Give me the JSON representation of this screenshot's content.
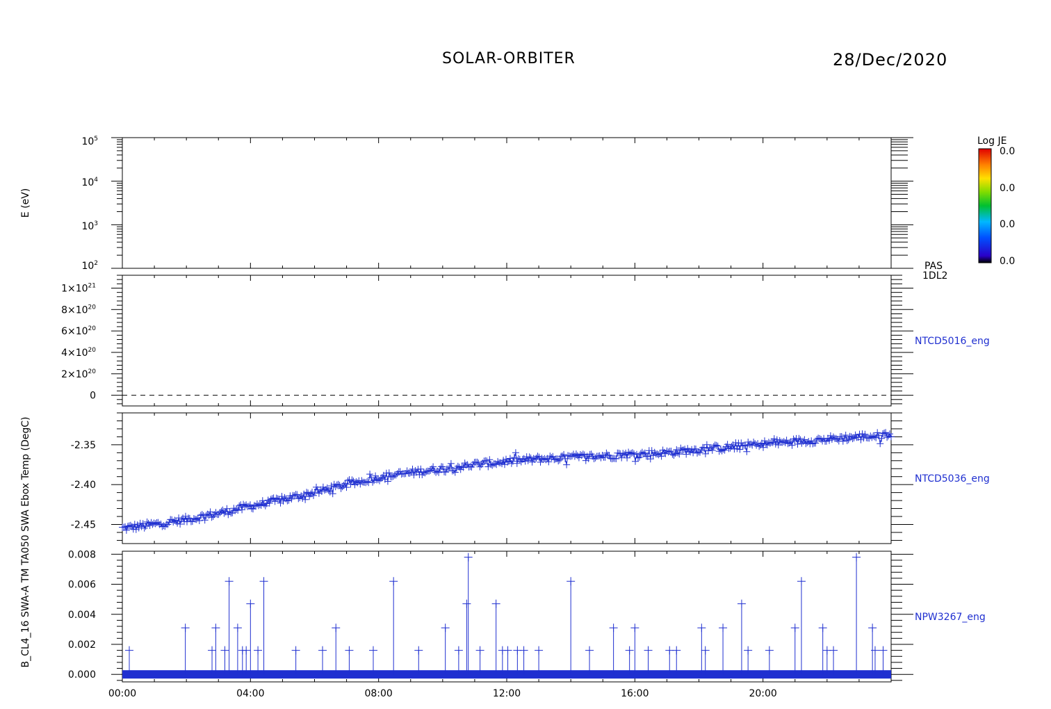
{
  "header": {
    "title": "SOLAR-ORBITER",
    "date": "28/Dec/2020"
  },
  "colorbar": {
    "title": "Log JE",
    "labels": [
      "0.0",
      "0.0",
      "0.0",
      "0.0"
    ]
  },
  "chart_data": [
    {
      "type": "heatmap",
      "ylabel": "E (eV)",
      "yscale": "log",
      "ylim": [
        100,
        100000
      ],
      "yticks": [
        {
          "base": "10",
          "exp": "5"
        },
        {
          "base": "10",
          "exp": "4"
        },
        {
          "base": "10",
          "exp": "3"
        },
        {
          "base": "10",
          "exp": "2"
        }
      ],
      "side_label": [
        "PAS",
        "1DL2"
      ],
      "values": []
    },
    {
      "type": "line",
      "ylabel": "",
      "side_label": "NTCD5016_eng",
      "yticks": [
        {
          "mant": "1×10",
          "exp": "21"
        },
        {
          "mant": "8×10",
          "exp": "20"
        },
        {
          "mant": "6×10",
          "exp": "20"
        },
        {
          "mant": "4×10",
          "exp": "20"
        },
        {
          "mant": "2×10",
          "exp": "20"
        },
        {
          "mant": "0",
          "exp": ""
        }
      ],
      "ytick_values": [
        1e+21,
        8e+20,
        6e+20,
        4e+20,
        2e+20,
        0
      ],
      "ylim": [
        -1e+20,
        1.12e+21
      ],
      "series": [
        {
          "x": [
            "00:00",
            "24:00"
          ],
          "y": [
            0,
            0
          ]
        }
      ]
    },
    {
      "type": "scatter",
      "ylabel": "B_CL4_16 SWA-A TM TA050 SWA Ebox Temp (DegC)",
      "side_label": "NTCD5036_eng",
      "ylim": [
        -2.474,
        -2.31
      ],
      "yticks": [
        "-2.35",
        "-2.40",
        "-2.45"
      ],
      "ytick_values": [
        -2.35,
        -2.4,
        -2.45
      ],
      "series": [
        {
          "x": [
            "00:00",
            "01:00",
            "02:00",
            "03:00",
            "04:00",
            "05:00",
            "06:00",
            "07:00",
            "08:00",
            "09:00",
            "10:00",
            "11:00",
            "12:00",
            "13:00",
            "14:00",
            "15:00",
            "16:00",
            "17:00",
            "18:00",
            "19:00",
            "20:00",
            "21:00",
            "22:00",
            "23:00",
            "24:00"
          ],
          "y": [
            -2.455,
            -2.45,
            -2.444,
            -2.436,
            -2.427,
            -2.419,
            -2.41,
            -2.4,
            -2.391,
            -2.385,
            -2.38,
            -2.375,
            -2.371,
            -2.368,
            -2.366,
            -2.364,
            -2.362,
            -2.36,
            -2.356,
            -2.353,
            -2.349,
            -2.346,
            -2.343,
            -2.34,
            -2.338
          ]
        }
      ]
    },
    {
      "type": "line",
      "ylabel": "",
      "side_label": "NPW3267_eng",
      "ylim": [
        -0.0005,
        0.0082
      ],
      "yticks": [
        "0.008",
        "0.006",
        "0.004",
        "0.002",
        "0.000"
      ],
      "ytick_values": [
        0.008,
        0.006,
        0.004,
        0.002,
        0.0
      ],
      "xticks": [
        "00:00",
        "04:00",
        "08:00",
        "12:00",
        "16:00",
        "20:00"
      ],
      "xlim": [
        "00:00",
        "24:00"
      ],
      "spikes": [
        {
          "x": "00:13",
          "y": 0.0016
        },
        {
          "x": "01:58",
          "y": 0.0031
        },
        {
          "x": "02:48",
          "y": 0.0016
        },
        {
          "x": "02:55",
          "y": 0.0031
        },
        {
          "x": "03:12",
          "y": 0.0016
        },
        {
          "x": "03:20",
          "y": 0.0062
        },
        {
          "x": "03:36",
          "y": 0.0031
        },
        {
          "x": "03:45",
          "y": 0.0016
        },
        {
          "x": "03:52",
          "y": 0.0016
        },
        {
          "x": "04:00",
          "y": 0.0047
        },
        {
          "x": "04:14",
          "y": 0.0016
        },
        {
          "x": "04:25",
          "y": 0.0062
        },
        {
          "x": "05:25",
          "y": 0.0016
        },
        {
          "x": "06:15",
          "y": 0.0016
        },
        {
          "x": "06:40",
          "y": 0.0031
        },
        {
          "x": "07:05",
          "y": 0.0016
        },
        {
          "x": "07:50",
          "y": 0.0016
        },
        {
          "x": "08:28",
          "y": 0.0062
        },
        {
          "x": "09:15",
          "y": 0.0016
        },
        {
          "x": "10:05",
          "y": 0.0031
        },
        {
          "x": "10:30",
          "y": 0.0016
        },
        {
          "x": "10:45",
          "y": 0.0047
        },
        {
          "x": "10:48",
          "y": 0.0078
        },
        {
          "x": "11:10",
          "y": 0.0016
        },
        {
          "x": "11:40",
          "y": 0.0047
        },
        {
          "x": "11:52",
          "y": 0.0016
        },
        {
          "x": "12:02",
          "y": 0.0016
        },
        {
          "x": "12:20",
          "y": 0.0016
        },
        {
          "x": "12:32",
          "y": 0.0016
        },
        {
          "x": "13:00",
          "y": 0.0016
        },
        {
          "x": "14:00",
          "y": 0.0062
        },
        {
          "x": "14:35",
          "y": 0.0016
        },
        {
          "x": "15:20",
          "y": 0.0031
        },
        {
          "x": "15:50",
          "y": 0.0016
        },
        {
          "x": "16:00",
          "y": 0.0031
        },
        {
          "x": "16:25",
          "y": 0.0016
        },
        {
          "x": "17:05",
          "y": 0.0016
        },
        {
          "x": "17:18",
          "y": 0.0016
        },
        {
          "x": "18:05",
          "y": 0.0031
        },
        {
          "x": "18:12",
          "y": 0.0016
        },
        {
          "x": "18:45",
          "y": 0.0031
        },
        {
          "x": "19:20",
          "y": 0.0047
        },
        {
          "x": "19:32",
          "y": 0.0016
        },
        {
          "x": "20:12",
          "y": 0.0016
        },
        {
          "x": "21:00",
          "y": 0.0031
        },
        {
          "x": "21:12",
          "y": 0.0062
        },
        {
          "x": "21:52",
          "y": 0.0031
        },
        {
          "x": "22:00",
          "y": 0.0016
        },
        {
          "x": "22:12",
          "y": 0.0016
        },
        {
          "x": "22:55",
          "y": 0.0078
        },
        {
          "x": "23:25",
          "y": 0.0031
        },
        {
          "x": "23:30",
          "y": 0.0016
        },
        {
          "x": "23:45",
          "y": 0.0016
        }
      ]
    }
  ]
}
